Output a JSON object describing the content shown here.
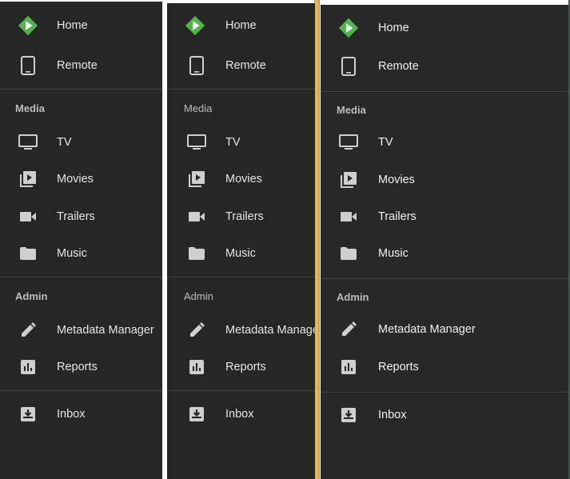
{
  "panels": [
    {
      "home": "Home",
      "remote": "Remote",
      "media_title": "Media",
      "tv": "TV",
      "movies": "Movies",
      "trailers": "Trailers",
      "music": "Music",
      "admin_title": "Admin",
      "metadata": "Metadata Manager",
      "reports": "Reports",
      "inbox": "Inbox"
    },
    {
      "home": "Home",
      "remote": "Remote",
      "media_title": "Media",
      "tv": "TV",
      "movies": "Movies",
      "trailers": "Trailers",
      "music": "Music",
      "admin_title": "Admin",
      "metadata": "Metadata Manager",
      "reports": "Reports",
      "inbox": "Inbox"
    },
    {
      "home": "Home",
      "remote": "Remote",
      "media_title": "Media",
      "tv": "TV",
      "movies": "Movies",
      "trailers": "Trailers",
      "music": "Music",
      "admin_title": "Admin",
      "metadata": "Metadata Manager",
      "reports": "Reports",
      "inbox": "Inbox"
    }
  ],
  "colors": {
    "panel_bg": "#262626",
    "accent_green": "#52b54b",
    "divider": "#424242",
    "text": "#e6e6e6",
    "section_text": "#bdbdbd",
    "separator_gold": "#e8c36a"
  }
}
